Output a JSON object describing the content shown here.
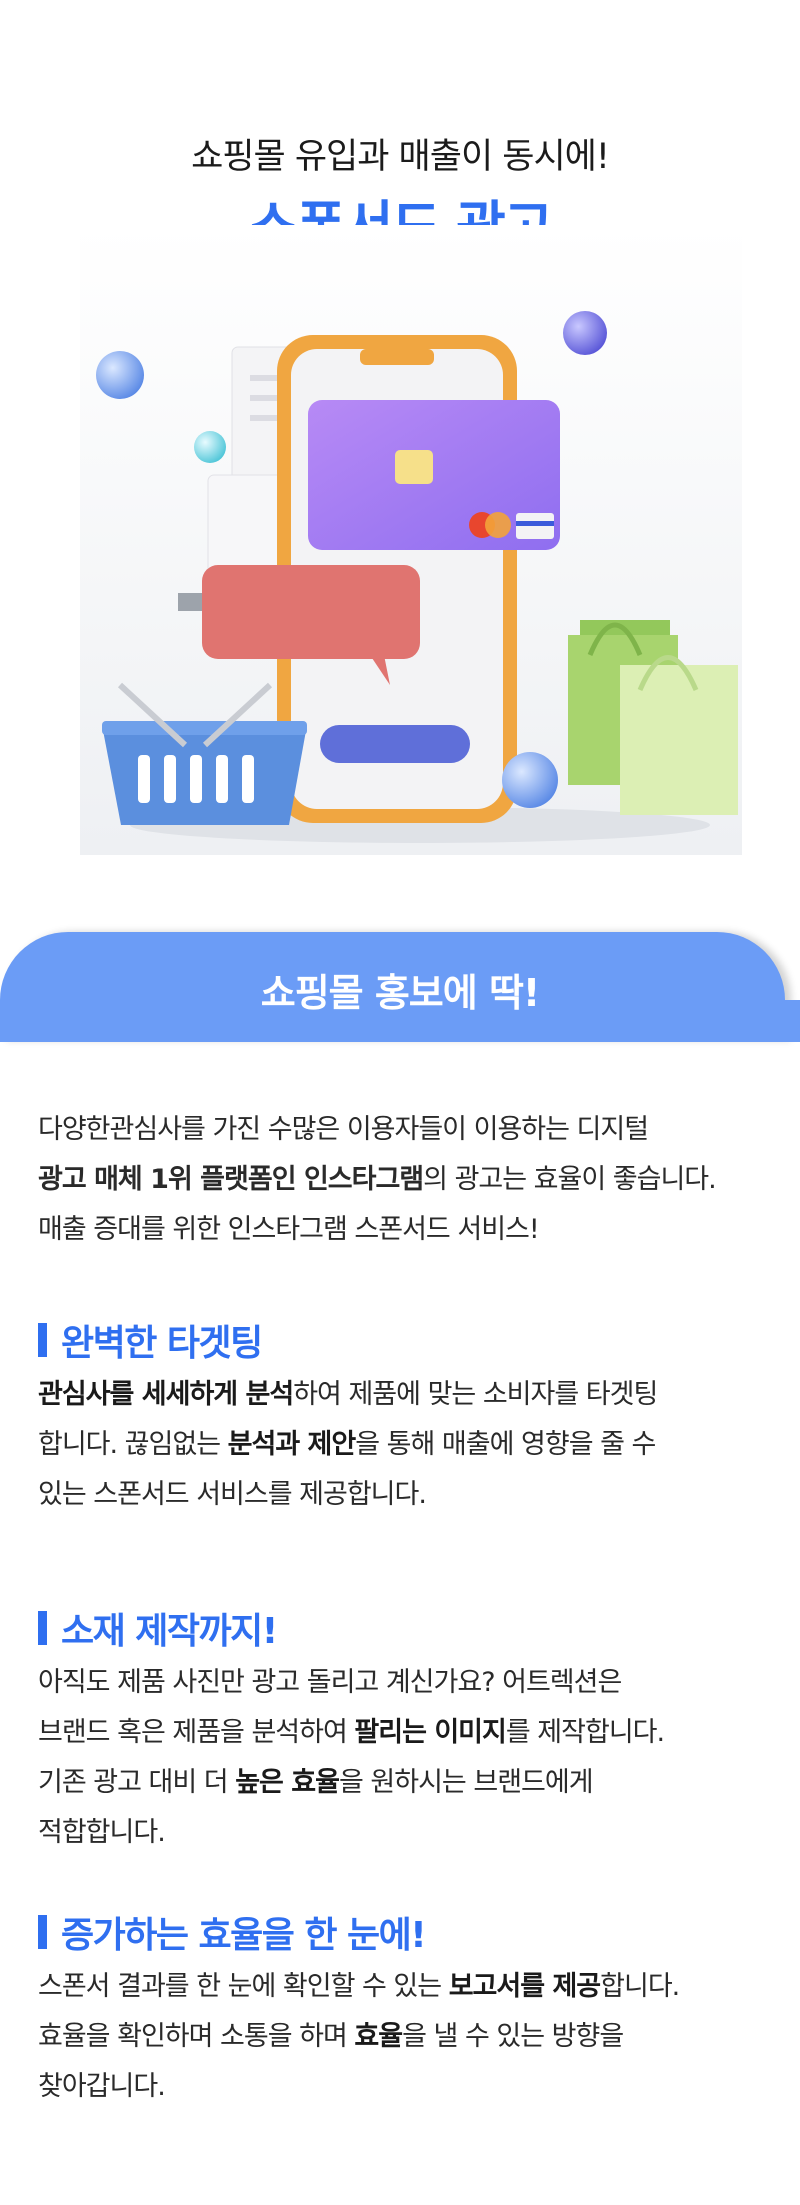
{
  "hero": {
    "subtitle": "쇼핑몰 유입과 매출이 동시에!",
    "title": "스폰서드 광고"
  },
  "banner": {
    "title": "쇼핑몰 홍보에 딱!"
  },
  "intro": {
    "line1": "다양한관심사를 가진 수많은 이용자들이 이용하는 디지털",
    "line2_bold": "광고 매체 1위 플랫폼인 인스타그램",
    "line2_rest": "의 광고는 효율이 좋습니다.",
    "line3": "매출 증대를 위한 인스타그램 스폰서드 서비스!"
  },
  "sections": [
    {
      "title": "완벽한 타겟팅",
      "l1_bold": "관심사를 세세하게 분석",
      "l1_rest": "하여 제품에 맞는 소비자를 타겟팅",
      "l2_a": "합니다. 끊임없는 ",
      "l2_bold": "분석과 제안",
      "l2_b": "을 통해 매출에 영향을 줄 수",
      "l3": "있는 스폰서드 서비스를 제공합니다."
    },
    {
      "title": "소재 제작까지!",
      "l1": "아직도 제품 사진만 광고 돌리고 계신가요? 어트렉션은",
      "l2_a": "브랜드 혹은 제품을 분석하여 ",
      "l2_bold": "팔리는 이미지",
      "l2_b": "를 제작합니다.",
      "l3_a": "기존 광고 대비 더 ",
      "l3_bold": "높은 효율",
      "l3_b": "을 원하시는 브랜드에게",
      "l4": "적합합니다."
    },
    {
      "title": "증가하는 효율을 한 눈에!",
      "l1_a": "스폰서 결과를 한 눈에 확인할 수 있는 ",
      "l1_bold": "보고서를 제공",
      "l1_b": "합니다.",
      "l2_a": "효율을 확인하며 소통을 하며 ",
      "l2_bold": "효율",
      "l2_b": "을 낼 수 있는 방향을",
      "l3": "찾아갑니다."
    }
  ],
  "colors": {
    "accent": "#2f6ff0",
    "banner": "#6b9cf6"
  }
}
